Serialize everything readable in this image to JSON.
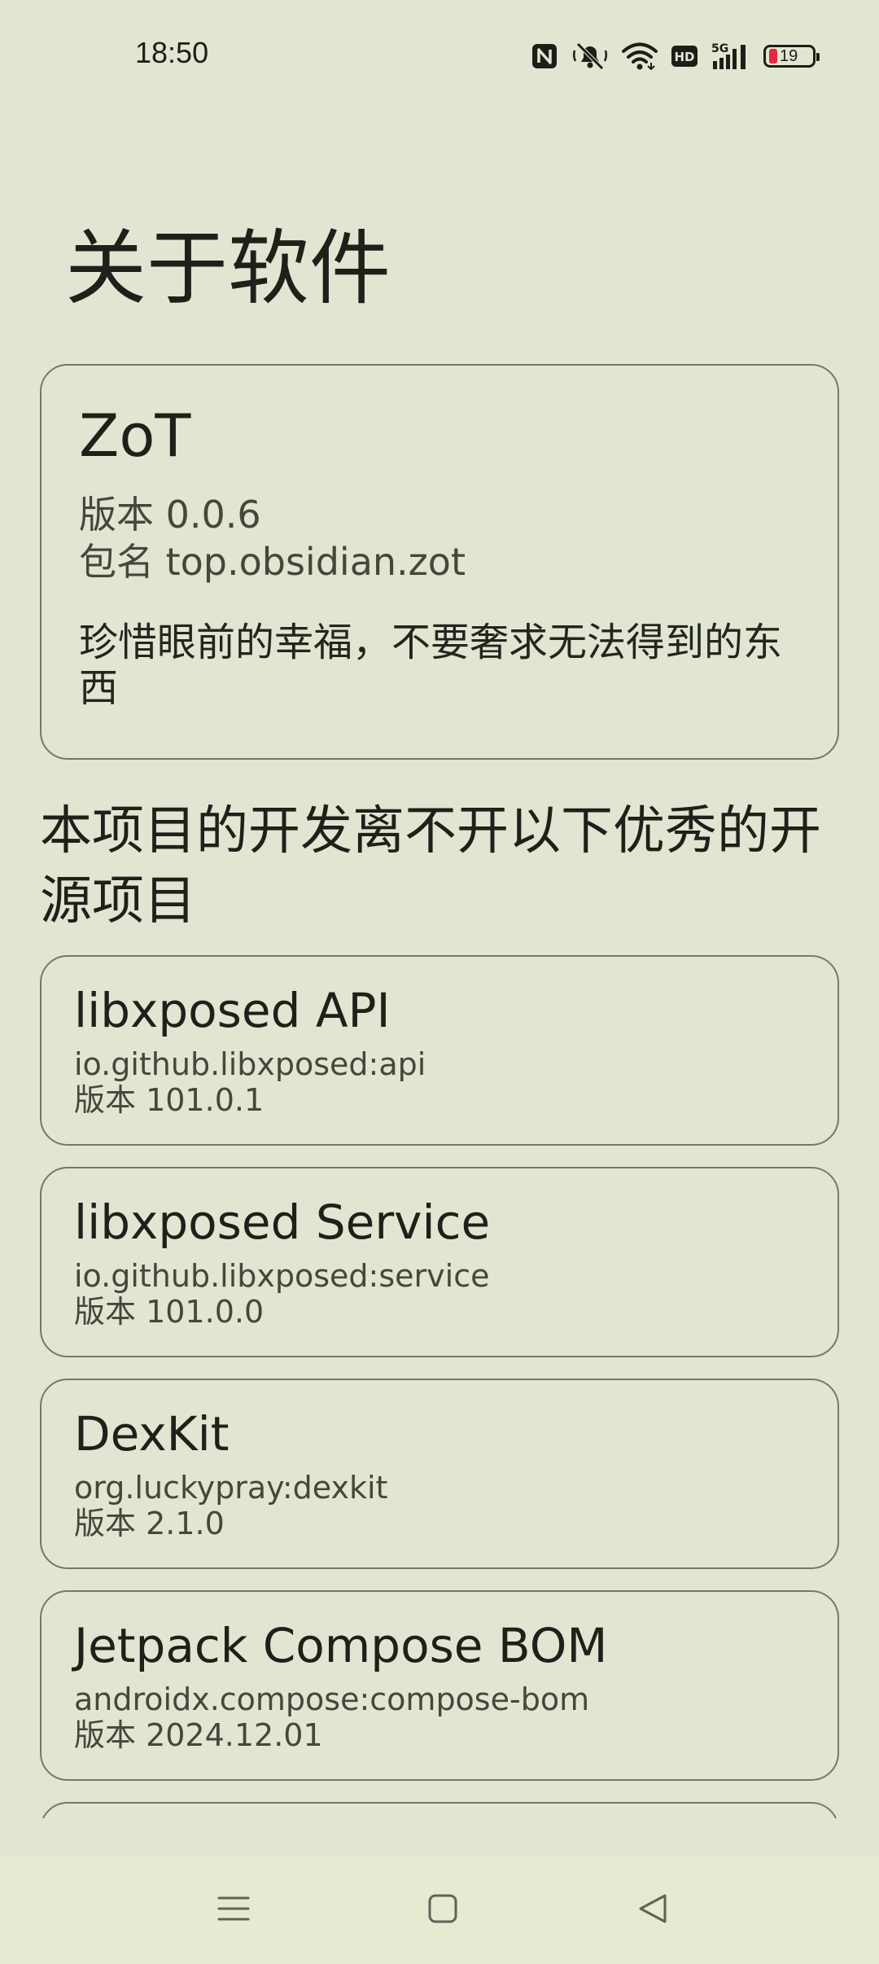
{
  "status_bar": {
    "time": "18:50",
    "icons": [
      "nfc-icon",
      "silent-icon",
      "wifi-icon",
      "hd-icon",
      "5g-signal-icon",
      "battery-icon"
    ],
    "battery_level": "19",
    "battery_color": "#e8283c"
  },
  "page": {
    "title": "关于软件"
  },
  "app_info": {
    "name": "ZoT",
    "version": "版本 0.0.6",
    "package": "包名 top.obsidian.zot",
    "description": "珍惜眼前的幸福，不要奢求无法得到的东西"
  },
  "libraries": {
    "heading": "本项目的开发离不开以下优秀的开源项目",
    "items": [
      {
        "name": "libxposed API",
        "id": "io.github.libxposed:api",
        "version": "版本 101.0.1"
      },
      {
        "name": "libxposed Service",
        "id": "io.github.libxposed:service",
        "version": "版本 101.0.0"
      },
      {
        "name": "DexKit",
        "id": "org.luckypray:dexkit",
        "version": "版本 2.1.0"
      },
      {
        "name": "Jetpack Compose BOM",
        "id": "androidx.compose:compose-bom",
        "version": "版本 2024.12.01"
      }
    ]
  },
  "nav_bar": {
    "buttons": [
      "menu-icon",
      "home-icon",
      "back-icon"
    ]
  },
  "colors": {
    "background": "#e1e6d3",
    "card_border": "#74786a",
    "text_primary": "#1e2119",
    "text_secondary": "#44483b",
    "nav_background": "#e6ead1"
  }
}
